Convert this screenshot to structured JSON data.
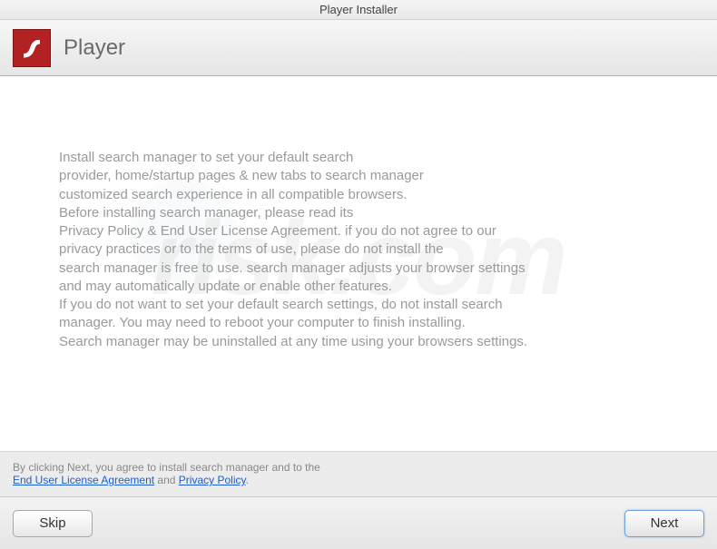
{
  "window": {
    "title": "Player Installer"
  },
  "header": {
    "title": "Player",
    "icon_name": "flash-player-icon"
  },
  "body": {
    "lines": [
      "Install search manager to set your default search",
      "provider, home/startup pages & new tabs to search manager",
      "customized search experience in all compatible browsers.",
      "Before installing search manager, please read its",
      "Privacy Policy & End User License Agreement. if you do not agree to our",
      "privacy practices or to the terms of use, please do not install the",
      "search manager is free to use. search manager adjusts your browser settings",
      "and may automatically update or enable other features.",
      "If you do not want to set your default search settings, do not install search",
      "manager. You may need to reboot your computer to finish installing.",
      "Search manager may be uninstalled at any time using your browsers settings."
    ]
  },
  "agreement": {
    "prefix": "By clicking Next, you agree to install search manager and to the",
    "eula_link": "End User License Agreement",
    "joiner": " and ",
    "privacy_link": "Privacy Policy",
    "suffix": "."
  },
  "buttons": {
    "skip": "Skip",
    "next": "Next"
  },
  "watermark": {
    "text": "risk.com"
  }
}
